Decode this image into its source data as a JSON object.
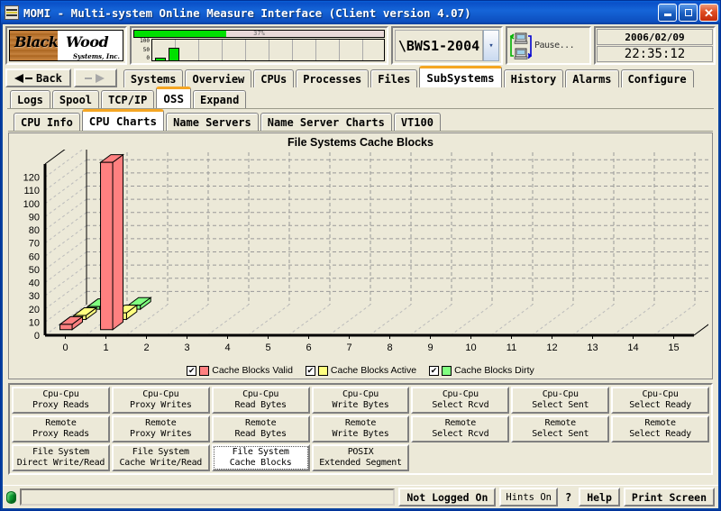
{
  "window": {
    "title": "MOMI - Multi-system Online Measure Interface (Client version 4.07)",
    "minimize_label": "_",
    "maximize_label": "",
    "close_label": "✕"
  },
  "header": {
    "logo_primary": "Black",
    "logo_secondary": "Wood",
    "logo_tagline": "Systems, Inc.",
    "cpu_progress_pct": "37%",
    "cpu_scale": [
      "100",
      "50",
      "0"
    ],
    "system_name": "\\BWS1-2004",
    "system_dropdown_icon": "chevron-down-icon",
    "pause_label": "Pause...",
    "date": "2006/02/09",
    "time": "22:35:12"
  },
  "nav": {
    "back_label": "Back",
    "forward_label": "",
    "tabs": [
      {
        "label": "Systems",
        "active": false
      },
      {
        "label": "Overview",
        "active": false
      },
      {
        "label": "CPUs",
        "active": false
      },
      {
        "label": "Processes",
        "active": false
      },
      {
        "label": "Files",
        "active": false
      },
      {
        "label": "SubSystems",
        "active": true
      },
      {
        "label": "History",
        "active": false
      },
      {
        "label": "Alarms",
        "active": false
      },
      {
        "label": "Configure",
        "active": false
      }
    ],
    "subtabs": [
      {
        "label": "Logs",
        "active": false
      },
      {
        "label": "Spool",
        "active": false
      },
      {
        "label": "TCP/IP",
        "active": false
      },
      {
        "label": "OSS",
        "active": true
      },
      {
        "label": "Expand",
        "active": false
      }
    ],
    "subsubtabs": [
      {
        "label": "CPU Info",
        "active": false
      },
      {
        "label": "CPU Charts",
        "active": true
      },
      {
        "label": "Name Servers",
        "active": false
      },
      {
        "label": "Name Server Charts",
        "active": false
      },
      {
        "label": "VT100",
        "active": false
      }
    ]
  },
  "chart_data": {
    "type": "bar",
    "title": "File Systems Cache Blocks",
    "xlabel": "",
    "ylabel": "",
    "categories": [
      "0",
      "1",
      "2",
      "3",
      "4",
      "5",
      "6",
      "7",
      "8",
      "9",
      "10",
      "11",
      "12",
      "13",
      "14",
      "15"
    ],
    "yticks": [
      "0",
      "10",
      "20",
      "30",
      "40",
      "50",
      "60",
      "70",
      "80",
      "90",
      "100",
      "110",
      "120"
    ],
    "ylim": [
      0,
      130
    ],
    "grid": true,
    "threeD": true,
    "legend_position": "bottom",
    "series": [
      {
        "name": "Cache Blocks Valid",
        "color": "#FF8080",
        "checked": true,
        "values": [
          4,
          127,
          0,
          0,
          0,
          0,
          0,
          0,
          0,
          0,
          0,
          0,
          0,
          0,
          0,
          0
        ]
      },
      {
        "name": "Cache Blocks Active",
        "color": "#FFFF80",
        "checked": true,
        "values": [
          3,
          5,
          0,
          0,
          0,
          0,
          0,
          0,
          0,
          0,
          0,
          0,
          0,
          0,
          0,
          0
        ]
      },
      {
        "name": "Cache Blocks Dirty",
        "color": "#80FF80",
        "checked": true,
        "values": [
          2,
          3,
          0,
          0,
          0,
          0,
          0,
          0,
          0,
          0,
          0,
          0,
          0,
          0,
          0,
          0
        ]
      }
    ]
  },
  "buttons": {
    "grid": [
      {
        "line1": "Cpu-Cpu",
        "line2": "Proxy Reads",
        "selected": false
      },
      {
        "line1": "Cpu-Cpu",
        "line2": "Proxy Writes",
        "selected": false
      },
      {
        "line1": "Cpu-Cpu",
        "line2": "Read Bytes",
        "selected": false
      },
      {
        "line1": "Cpu-Cpu",
        "line2": "Write Bytes",
        "selected": false
      },
      {
        "line1": "Cpu-Cpu",
        "line2": "Select Rcvd",
        "selected": false
      },
      {
        "line1": "Cpu-Cpu",
        "line2": "Select Sent",
        "selected": false
      },
      {
        "line1": "Cpu-Cpu",
        "line2": "Select Ready",
        "selected": false
      },
      {
        "line1": "Remote",
        "line2": "Proxy Reads",
        "selected": false
      },
      {
        "line1": "Remote",
        "line2": "Proxy Writes",
        "selected": false
      },
      {
        "line1": "Remote",
        "line2": "Read Bytes",
        "selected": false
      },
      {
        "line1": "Remote",
        "line2": "Write Bytes",
        "selected": false
      },
      {
        "line1": "Remote",
        "line2": "Select Rcvd",
        "selected": false
      },
      {
        "line1": "Remote",
        "line2": "Select Sent",
        "selected": false
      },
      {
        "line1": "Remote",
        "line2": "Select Ready",
        "selected": false
      },
      {
        "line1": "File System",
        "line2": "Direct Write/Read",
        "selected": false
      },
      {
        "line1": "File System",
        "line2": "Cache Write/Read",
        "selected": false
      },
      {
        "line1": "File System",
        "line2": "Cache Blocks",
        "selected": true
      },
      {
        "line1": "POSIX",
        "line2": "Extended Segment",
        "selected": false
      }
    ]
  },
  "statusbar": {
    "message": "",
    "login_label": "Not Logged On",
    "hints_label": "Hints On",
    "help_q_label": "?",
    "help_label": "Help",
    "print_label": "Print Screen"
  }
}
